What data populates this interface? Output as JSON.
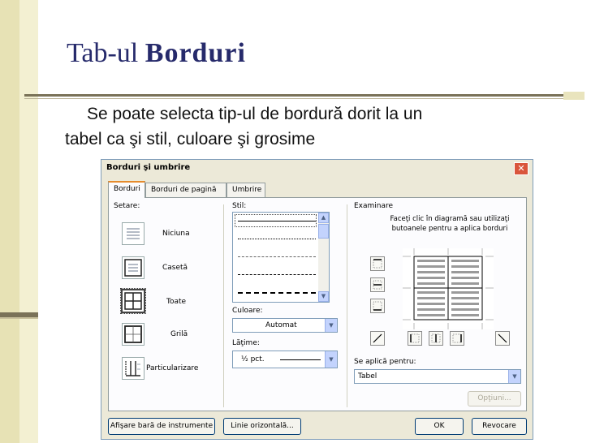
{
  "slide": {
    "title_prefix": "Tab-ul ",
    "title_bold": "Borduri",
    "body_line1": "Se poate selecta tip-ul de bordură dorit la un",
    "body_line2": "tabel ca şi stil, culoare şi grosime"
  },
  "dialog": {
    "title": "Borduri şi umbrire",
    "close_label": "✕",
    "tabs": [
      "Borduri",
      "Borduri de pagină",
      "Umbrire"
    ],
    "setting": {
      "heading": "Setare:",
      "options": [
        "Niciuna",
        "Casetă",
        "Toate",
        "Grilă",
        "Particularizare"
      ]
    },
    "style": {
      "heading": "Stil:"
    },
    "color": {
      "heading": "Culoare:",
      "value": "Automat"
    },
    "width": {
      "heading": "Lăţime:",
      "value": "½ pct."
    },
    "preview": {
      "heading": "Examinare",
      "hint_line1": "Faceţi clic în diagramă sau utilizaţi",
      "hint_line2": "butoanele pentru a aplica borduri"
    },
    "apply_to": {
      "heading": "Se aplică pentru:",
      "value": "Tabel"
    },
    "buttons": {
      "options": "Opţiuni...",
      "toolbar": "Afişare bară de instrumente",
      "horizontal_line": "Linie orizontală...",
      "ok": "OK",
      "cancel": "Revocare"
    }
  },
  "colors": {
    "title_color": "#262a6b",
    "dialog_face": "#ece9d8",
    "active_tab_accent": "#e68b2c"
  }
}
